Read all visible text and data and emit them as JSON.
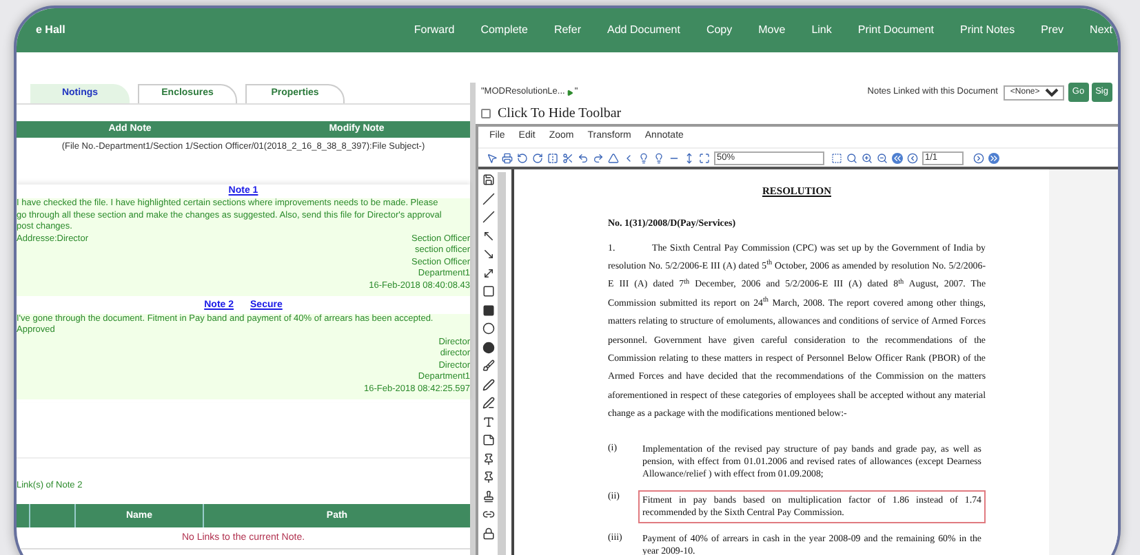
{
  "header": {
    "title": "e Hall",
    "actions": [
      "Forward",
      "Complete",
      "Refer",
      "Add Document",
      "Copy",
      "Move",
      "Link",
      "Print Document",
      "Print Notes",
      "Prev",
      "Next"
    ]
  },
  "left": {
    "tabs": [
      {
        "label": "Notings",
        "selected": true
      },
      {
        "label": "Enclosures",
        "selected": false
      },
      {
        "label": "Properties",
        "selected": false
      }
    ],
    "note_actions": [
      "Add Note",
      "Modify Note"
    ],
    "file_info": "(File No.-Department1/Section 1/Section Officer/01(2018_2_16_8_38_8_397):File Subject-)",
    "notes": [
      {
        "title": "Note 1",
        "body": [
          "I have checked the file. I have highlighted certain sections where improvements needs to be made. Please go through all these section and make the changes as suggested. Also, send this file for Director's approval post changes."
        ],
        "addressee": "Addresse:Director",
        "signature": [
          "Section Officer",
          "section officer",
          "Section Officer",
          "Department1",
          "16-Feb-2018 08:40:08.43"
        ]
      },
      {
        "title": "Note 2",
        "tag": "Secure",
        "body": [
          "I've gone through the document. Fitment in Pay band and payment of 40% of arrears has been accepted.",
          "Approved"
        ],
        "signature": [
          "Director",
          "director",
          "Director",
          "Department1",
          "16-Feb-2018 08:42:25.597"
        ]
      }
    ],
    "links": {
      "title": "Link(s) of Note 2",
      "columns": [
        "Name",
        "Path"
      ],
      "empty_message": "No Links to the current Note."
    }
  },
  "right": {
    "doc_title": "\"MODResolutionLe...",
    "doc_title_end": "\"",
    "linked_label": "Notes Linked with this Document",
    "linked_select": "<None>",
    "buttons": [
      "Go",
      "Sig"
    ],
    "toolbar_toggle": {
      "label": "Click To Hide Toolbar",
      "checked": false
    },
    "menu": [
      "File",
      "Edit",
      "Zoom",
      "Transform",
      "Annotate"
    ],
    "zoom_value": "50%",
    "page_value": "1/1",
    "document": {
      "heading": "RESOLUTION",
      "number": "No. 1(31)/2008/D(Pay/Services)",
      "paragraph": {
        "marker": "1.",
        "text": "The Sixth Central Pay Commission (CPC) was set up by the Government of India by resolution No. 5/2/2006-E III (A) dated 5$^{th}$ October, 2006 as amended by resolution No. 5/2/2006-E III (A) dated 7$^{th}$ December, 2006 and 5/2/2006-E III (A) dated 8$^{th}$ August, 2007. The Commission submitted its report on 24$^{th}$ March, 2008. The report covered among other things, matters relating to structure of emoluments, allowances and conditions of service of Armed Forces personnel. Government have given careful consideration to the recommendations of the Commission relating to these matters in respect of Personnel Below Officer Rank (PBOR) of the Armed Forces and have decided that the recommendations of the Commission on the matters aforementioned in respect of these categories of employees shall be accepted without any material change as a package with the modifications mentioned below:-"
      },
      "items": [
        {
          "marker": "(i)",
          "text": "Implementation of the revised pay structure of pay bands and grade pay, as well as pension, with effect from 01.01.2006 and revised rates of allowances (except Dearness Allowance/relief ) with effect from 01.09.2008;",
          "highlighted": false
        },
        {
          "marker": "(ii)",
          "text": "Fitment in pay bands based on multiplication factor of 1.86 instead of 1.74 recommended by the Sixth Central Pay Commission.",
          "highlighted": true
        },
        {
          "marker": "(iii)",
          "text": "Payment of 40% of arrears in cash in the year 2008-09 and the remaining 60% in the year 2009-10.",
          "highlighted": false
        }
      ]
    }
  }
}
